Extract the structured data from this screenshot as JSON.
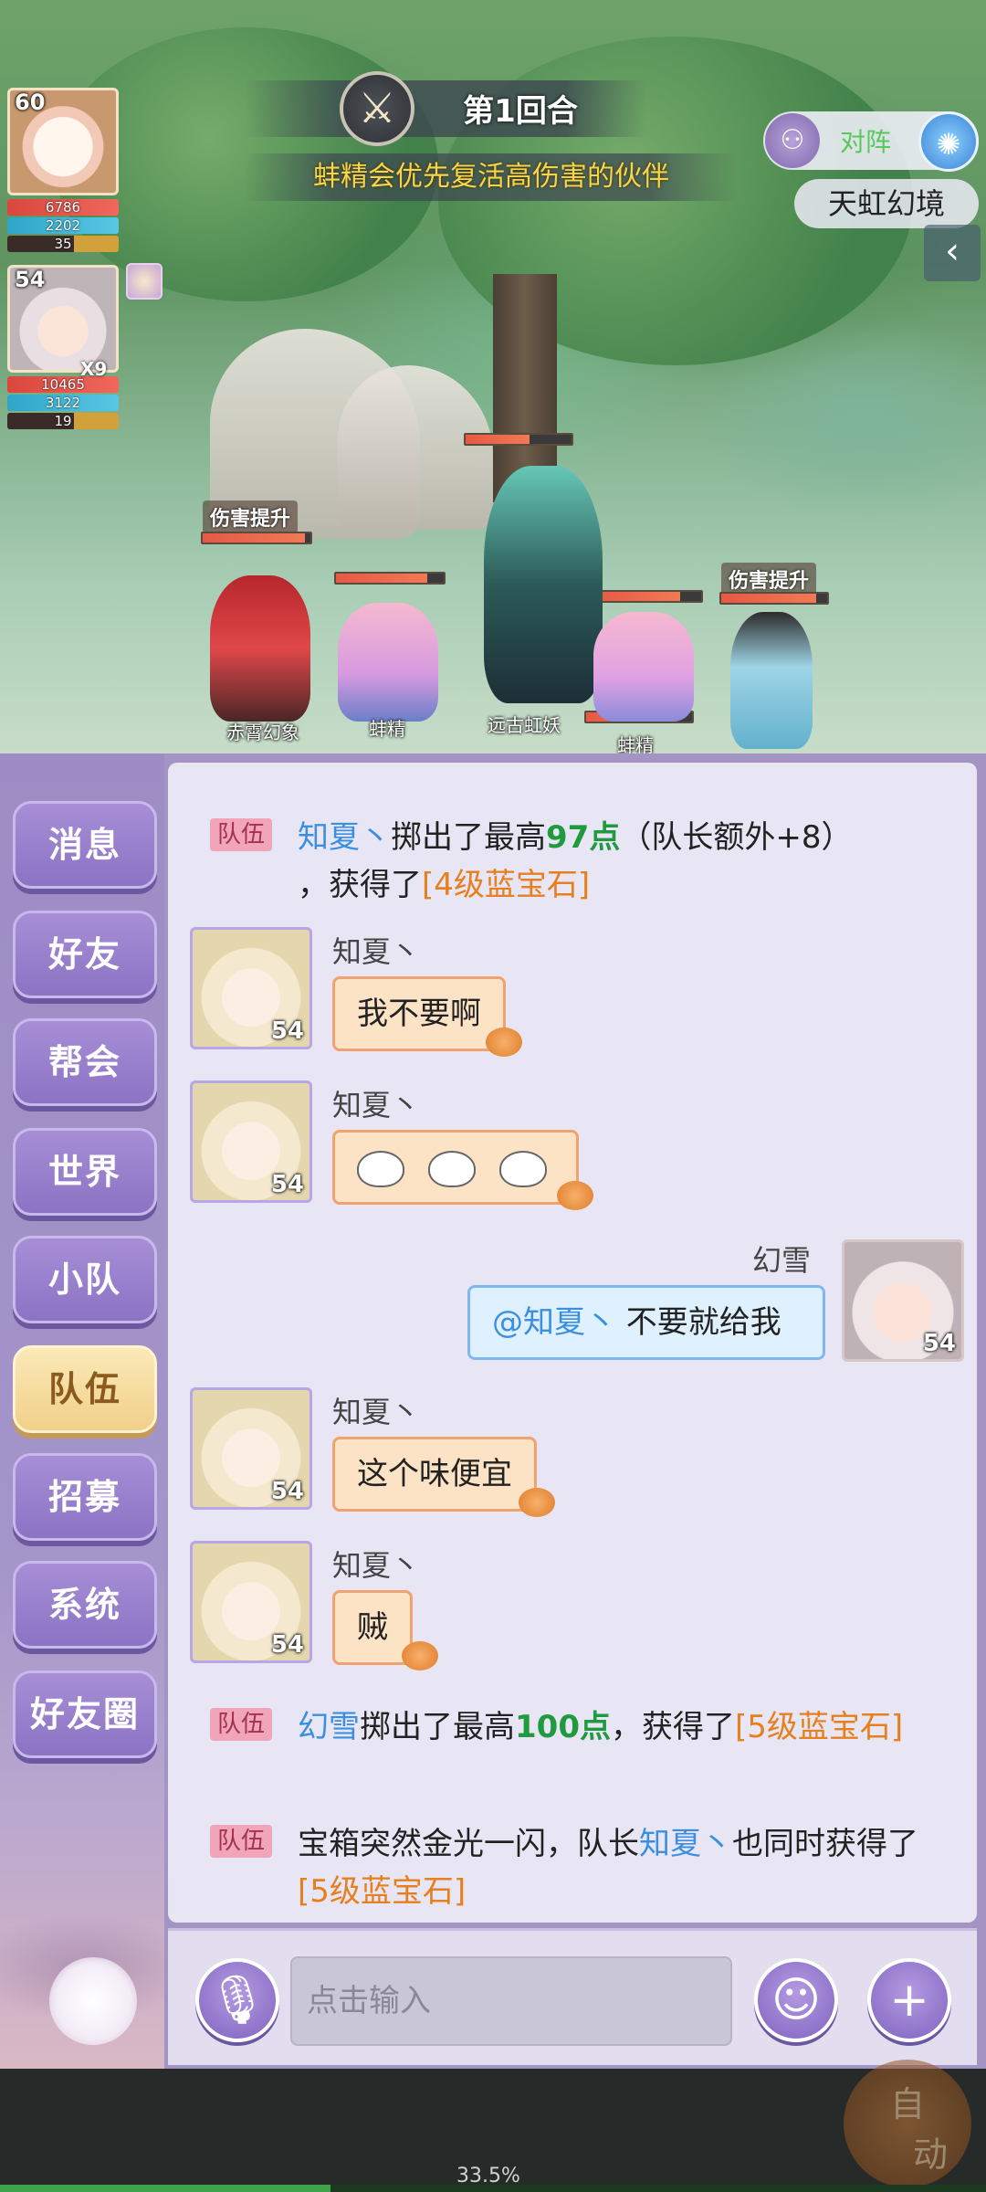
{
  "battle": {
    "round_label": "第1回合",
    "tip": "蚌精会优先复活高伤害的伙伴",
    "vs_label": "对阵",
    "realm": "天虹幻境",
    "buff_count": "X9",
    "player1": {
      "level": "60",
      "hp": "6786",
      "mp": "2202",
      "sp": "35"
    },
    "player2": {
      "level": "54",
      "hp": "10465",
      "mp": "3122",
      "sp": "19"
    },
    "damage_up_label": "伤害提升",
    "units": [
      {
        "name": "赤霄幻象",
        "hp": 0.95
      },
      {
        "name": "蚌精",
        "hp": 0.85
      },
      {
        "name": "远古虹妖",
        "hp": 0.6
      },
      {
        "name": "蚌精",
        "hp": 0.7
      }
    ]
  },
  "sidebar": {
    "items": [
      {
        "label": "消息"
      },
      {
        "label": "好友"
      },
      {
        "label": "帮会"
      },
      {
        "label": "世界"
      },
      {
        "label": "小队"
      },
      {
        "label": "队伍",
        "active": true
      },
      {
        "label": "招募"
      },
      {
        "label": "系统"
      },
      {
        "label": "好友圈"
      }
    ]
  },
  "chat": {
    "tag": "队伍",
    "sys1": {
      "name": "知夏丶",
      "text_a": "掷出了最高",
      "points": "97点",
      "text_b": "（队长额外+8）",
      "text_c": "，获得了",
      "item": "[4级蓝宝石]"
    },
    "msgs": [
      {
        "sender": "知夏丶",
        "level": "54",
        "text": "我不要啊"
      },
      {
        "sender": "知夏丶",
        "level": "54",
        "text": ""
      },
      {
        "sender": "幻雪",
        "level": "54",
        "at": "@知夏丶",
        "text": " 不要就给我"
      },
      {
        "sender": "知夏丶",
        "level": "54",
        "text": "这个味便宜"
      },
      {
        "sender": "知夏丶",
        "level": "54",
        "text": "贼"
      }
    ],
    "sys2": {
      "name": "幻雪",
      "text_a": "掷出了最高",
      "points": "100点",
      "text_c": "，获得了",
      "item": "[5级蓝宝石]"
    },
    "sys3": {
      "text_a": "宝箱突然金光一闪，队长",
      "name": "知夏丶",
      "text_b": "也同时获得了",
      "item": "[5级蓝宝石]"
    }
  },
  "input": {
    "placeholder": "点击输入"
  },
  "auto": {
    "line1": "自",
    "line2": "动"
  },
  "progress": {
    "label": "33.5%",
    "value": 0.335
  },
  "colors": {
    "accent_purple": "#8c73c4",
    "tag_pink": "#f2a5b9",
    "name_blue": "#3b8fe0",
    "item_orange": "#e67f1e",
    "points_green": "#1f9a3e"
  }
}
